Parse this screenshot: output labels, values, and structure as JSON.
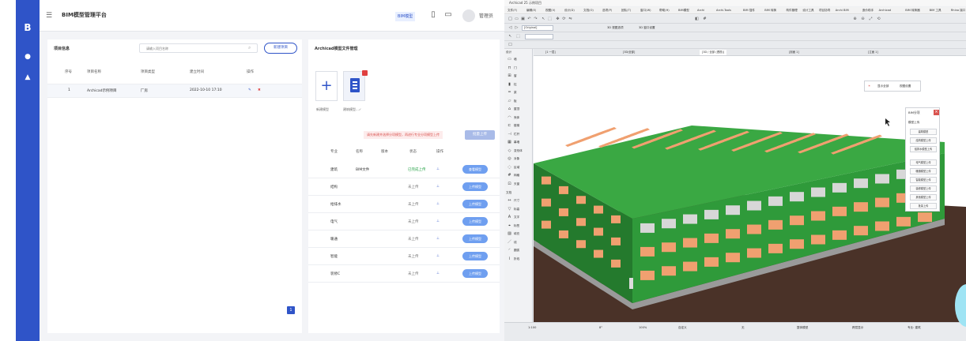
{
  "app": {
    "logo": "B",
    "title": "BIM模型管理平台",
    "top_tag": "BIM模型",
    "user": "管理员"
  },
  "project_panel": {
    "title": "项目信息",
    "search_placeholder": "请输入项目名称",
    "new_button": "新建项目",
    "columns": [
      "序号",
      "项目名称",
      "项目类型",
      "建立时间",
      "操作"
    ],
    "rows": [
      {
        "index": "1",
        "name": "Archicad示例项目",
        "type": "厂房",
        "created": "2022-10-10 17:10",
        "edit": "✎",
        "del": "✖"
      }
    ],
    "page": "1"
  },
  "model_panel": {
    "title": "Archicad模型文件管理",
    "add_label": "新建模型",
    "file_label": "建筑模型...✓",
    "hint": "请先新建并选择分项模型，再进行专业分项模型上传",
    "upload_button": "批量上传",
    "columns": [
      "专业",
      "名称",
      "版本",
      "状态",
      "操作"
    ],
    "rows": [
      {
        "discipline": "建筑",
        "name": "BIM文件",
        "version": "",
        "status": "已完成上传",
        "status_kind": "ok",
        "action": "查看模型"
      },
      {
        "discipline": "结构",
        "name": "",
        "version": "",
        "status": "未上传",
        "status_kind": "no",
        "action": "上传模型"
      },
      {
        "discipline": "给排水",
        "name": "",
        "version": "",
        "status": "未上传",
        "status_kind": "no",
        "action": "上传模型"
      },
      {
        "discipline": "电气",
        "name": "",
        "version": "",
        "status": "未上传",
        "status_kind": "no",
        "action": "上传模型"
      },
      {
        "discipline": "暖通",
        "name": "",
        "version": "",
        "status": "未上传",
        "status_kind": "no",
        "action": "上传模型"
      },
      {
        "discipline": "智能",
        "name": "",
        "version": "",
        "status": "未上传",
        "status_kind": "no",
        "action": "上传模型"
      },
      {
        "discipline": "装修C",
        "name": "",
        "version": "",
        "status": "未上传",
        "status_kind": "no",
        "action": "上传模型"
      }
    ]
  },
  "cad": {
    "window_title": "Archicad 25 示例项目",
    "menus": [
      "文件(F)",
      "编辑(E)",
      "视图(V)",
      "设计(D)",
      "文档(O)",
      "选项(P)",
      "团队(T)",
      "窗口(W)",
      "帮助(H)",
      "BIM模型",
      "Archi",
      "Archi-Tools",
      "BIM 插件",
      "BIM 转换",
      "构件管理",
      "设计工具",
      "项目协同",
      "Archi BIM",
      "造价助手",
      "Archicad",
      "BIM 转换器",
      "BIM 工具",
      "Rhino 接口",
      "帮助 2"
    ],
    "layer_combo": "[Original]",
    "toolbar_labels": [
      "3D 视图选项",
      "3D 窗口设置"
    ],
    "toolbox_head_1": "设计",
    "toolbox_head_2": "文档",
    "tools": [
      "墙",
      "门",
      "窗",
      "柱",
      "梁",
      "板",
      "屋顶",
      "壳体",
      "楼梯",
      "栏杆",
      "幕墙",
      "变形体",
      "对象",
      "区域",
      "网格",
      "天窗"
    ],
    "doc_tools": [
      "尺寸",
      "标高",
      "文字",
      "标签",
      "填充",
      "线",
      "圆弧",
      "折线"
    ],
    "tabs": [
      "[1 一层]",
      "[3D/全部]",
      "[3D / 全部 (透视)]",
      "[剖面 1]",
      "[立面 1]"
    ],
    "float_toolbar": [
      "☀",
      "显示全部",
      "视图设置"
    ],
    "palette": {
      "title": "BIM分项",
      "sub": "模型上传",
      "buttons": [
        "建筑模型",
        "结构模型上传",
        "给排水模型上传",
        "电气模型上传",
        "暖通模型上传",
        "智能模型上传",
        "装修模型上传",
        "其他模型上传",
        "批量上传"
      ],
      "note": "请选择:"
    },
    "status": [
      "1:100",
      "8°",
      "100%",
      "自定义",
      "无",
      "整体模型",
      "跨层显示",
      "专业: 建筑"
    ],
    "colors": {
      "roof": "#3aa843",
      "wall": "#2f9a3a",
      "wall_dark": "#247a2d",
      "window": "#f0a070",
      "ground": "#4a3228",
      "base": "#9a9a9a"
    }
  }
}
